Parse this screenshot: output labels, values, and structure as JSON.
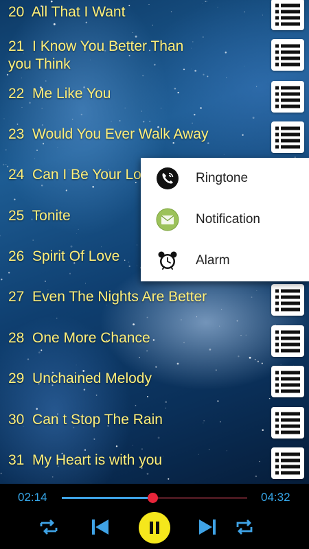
{
  "songs": [
    {
      "number": "20",
      "title": "All That I Want"
    },
    {
      "number": "21",
      "title": "I Know You Better Than",
      "title_line2": "you Think"
    },
    {
      "number": "22",
      "title": "Me Like You"
    },
    {
      "number": "23",
      "title": "Would You Ever Walk Away"
    },
    {
      "number": "24",
      "title": "Can I Be Your Lo"
    },
    {
      "number": "25",
      "title": "Tonite"
    },
    {
      "number": "26",
      "title": "Spirit Of Love"
    },
    {
      "number": "27",
      "title": "Even The Nights Are Better"
    },
    {
      "number": "28",
      "title": "One More Chance"
    },
    {
      "number": "29",
      "title": "Unchained Melody"
    },
    {
      "number": "30",
      "title": "Can t Stop The Rain"
    },
    {
      "number": "31",
      "title": "My Heart is with you"
    }
  ],
  "popup_menu": {
    "items": [
      {
        "label": "Ringtone",
        "icon": "phone-ringtone-icon"
      },
      {
        "label": "Notification",
        "icon": "envelope-notification-icon"
      },
      {
        "label": "Alarm",
        "icon": "alarm-clock-icon"
      }
    ]
  },
  "player": {
    "elapsed": "02:14",
    "duration": "04:32",
    "progress_fraction": 0.49,
    "state": "playing",
    "icons": [
      "shuffle-icon",
      "previous-icon",
      "pause-icon",
      "next-icon",
      "repeat-icon"
    ]
  },
  "colors": {
    "title_text": "#ffef7a",
    "accent_blue": "#36a6e8",
    "seek_thumb": "#e8253a",
    "play_button": "#f5e71c"
  }
}
